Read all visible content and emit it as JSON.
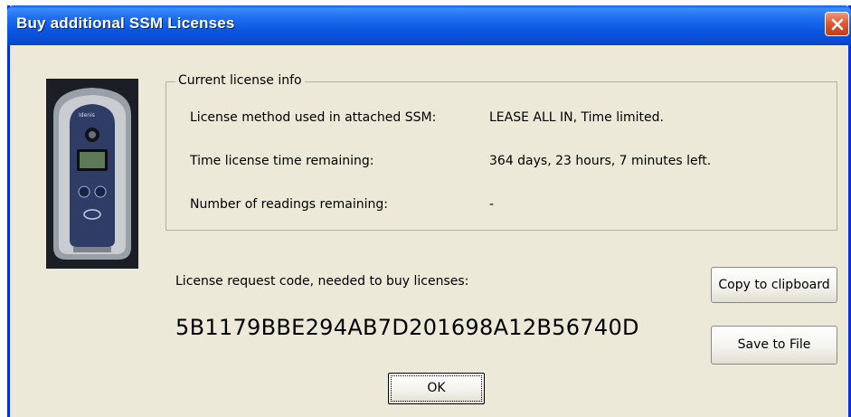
{
  "window": {
    "title": "Buy additional SSM Licenses"
  },
  "license_info": {
    "legend": "Current license info",
    "rows": [
      {
        "label": "License method used in attached SSM:",
        "value": "LEASE ALL IN, Time limited."
      },
      {
        "label": "Time license time remaining:",
        "value": "364 days, 23 hours, 7 minutes left."
      },
      {
        "label": "Number of readings remaining:",
        "value": "-"
      }
    ]
  },
  "request": {
    "label": "License request code, needed to buy licenses:",
    "code": "5B1179BBE294AB7D201698A12B56740D"
  },
  "buttons": {
    "copy": "Copy to clipboard",
    "save": "Save to File",
    "ok": "OK"
  },
  "colors": {
    "titlebar": "#0b55e0",
    "dialog_bg": "#ece9d8",
    "close": "#e15a33"
  }
}
